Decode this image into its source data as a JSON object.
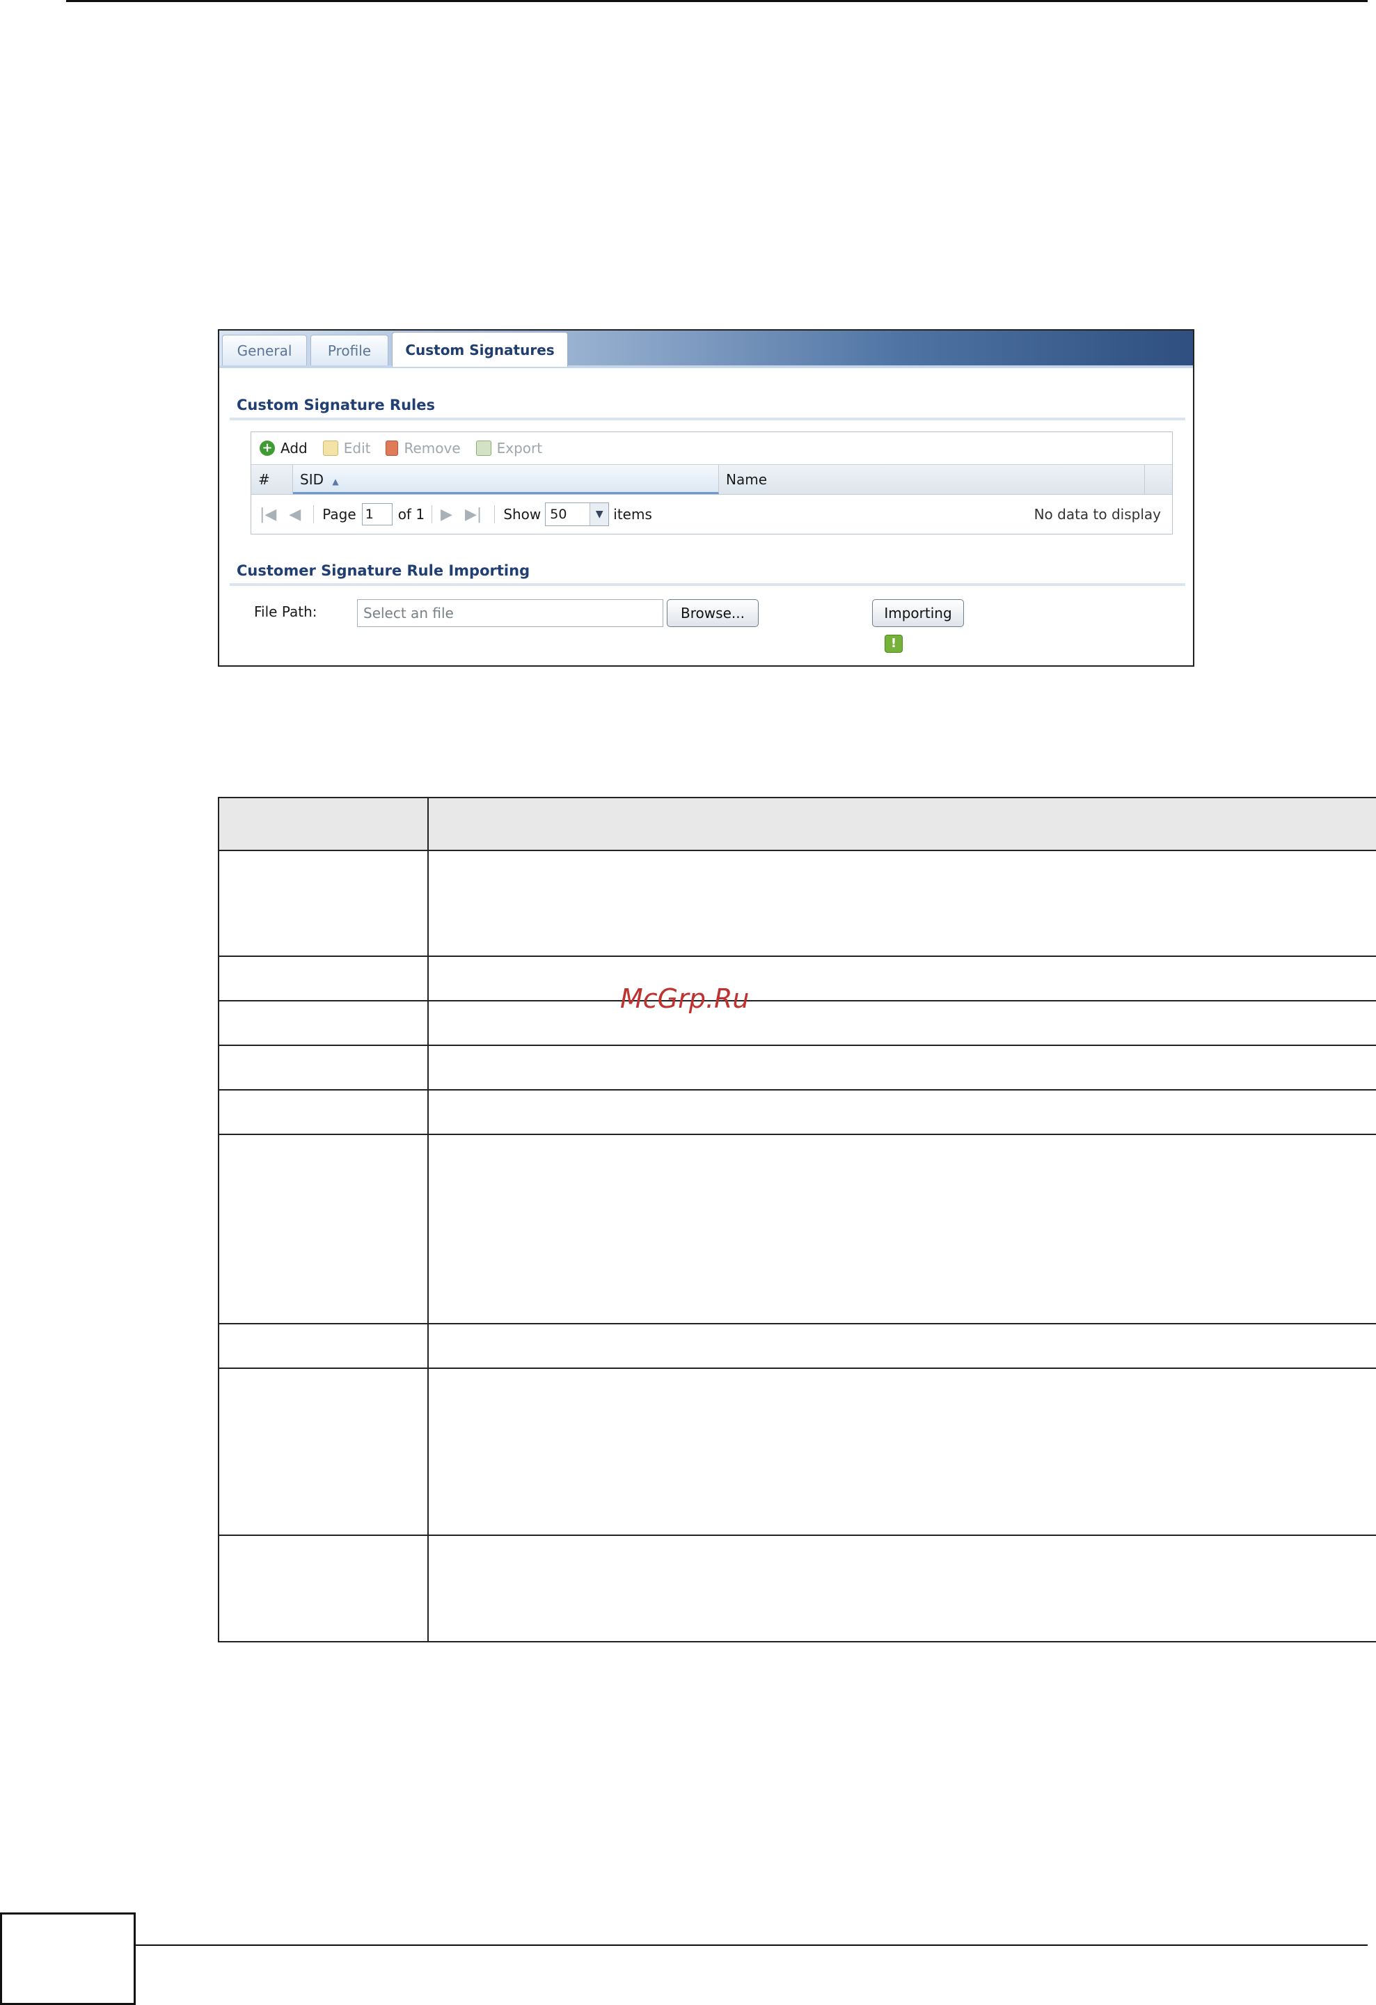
{
  "tabs": [
    {
      "label": "General",
      "active": false
    },
    {
      "label": "Profile",
      "active": false
    },
    {
      "label": "Custom Signatures",
      "active": true
    }
  ],
  "rules_section": {
    "title": "Custom Signature Rules",
    "toolbar": [
      {
        "label": "Add",
        "icon": "add-icon",
        "enabled": true
      },
      {
        "label": "Edit",
        "icon": "edit-icon",
        "enabled": false
      },
      {
        "label": "Remove",
        "icon": "remove-icon",
        "enabled": false
      },
      {
        "label": "Export",
        "icon": "export-icon",
        "enabled": false
      }
    ],
    "columns": [
      "#",
      "SID",
      "Name"
    ],
    "sort_indicator": "▲",
    "pager": {
      "page_label": "Page",
      "page_value": "1",
      "of_label": "of 1",
      "show_label": "Show",
      "show_value": "50",
      "items_label": "items",
      "empty_text": "No data to display"
    }
  },
  "import_section": {
    "title": "Customer Signature Rule Importing",
    "file_path_label": "File Path:",
    "file_placeholder": "Select an file",
    "browse_label": "Browse...",
    "import_label": "Importing",
    "status_icon": "!"
  },
  "watermark": "McGrp.Ru",
  "colors": {
    "tab_active_text": "#1f3e6e",
    "section_title": "#213f73",
    "add_icon": "#3f9c35",
    "warn_icon": "#76b13a",
    "watermark": "#c0322f"
  }
}
